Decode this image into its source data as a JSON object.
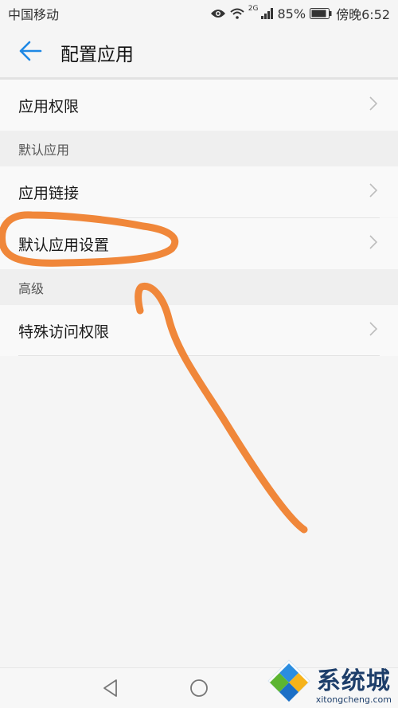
{
  "status_bar": {
    "carrier": "中国移动",
    "network": "2G",
    "battery": "85%",
    "time": "傍晚6:52"
  },
  "app_bar": {
    "title": "配置应用"
  },
  "rows": {
    "app_permissions": "应用权限",
    "app_links": "应用链接",
    "default_app_settings": "默认应用设置",
    "special_access": "特殊访问权限"
  },
  "sections": {
    "default_apps": "默认应用",
    "advanced": "高级"
  },
  "watermark": {
    "title": "系统城",
    "url": "xitongcheng.com"
  },
  "colors": {
    "accent": "#1e88e5",
    "annotation": "#f0873a"
  }
}
